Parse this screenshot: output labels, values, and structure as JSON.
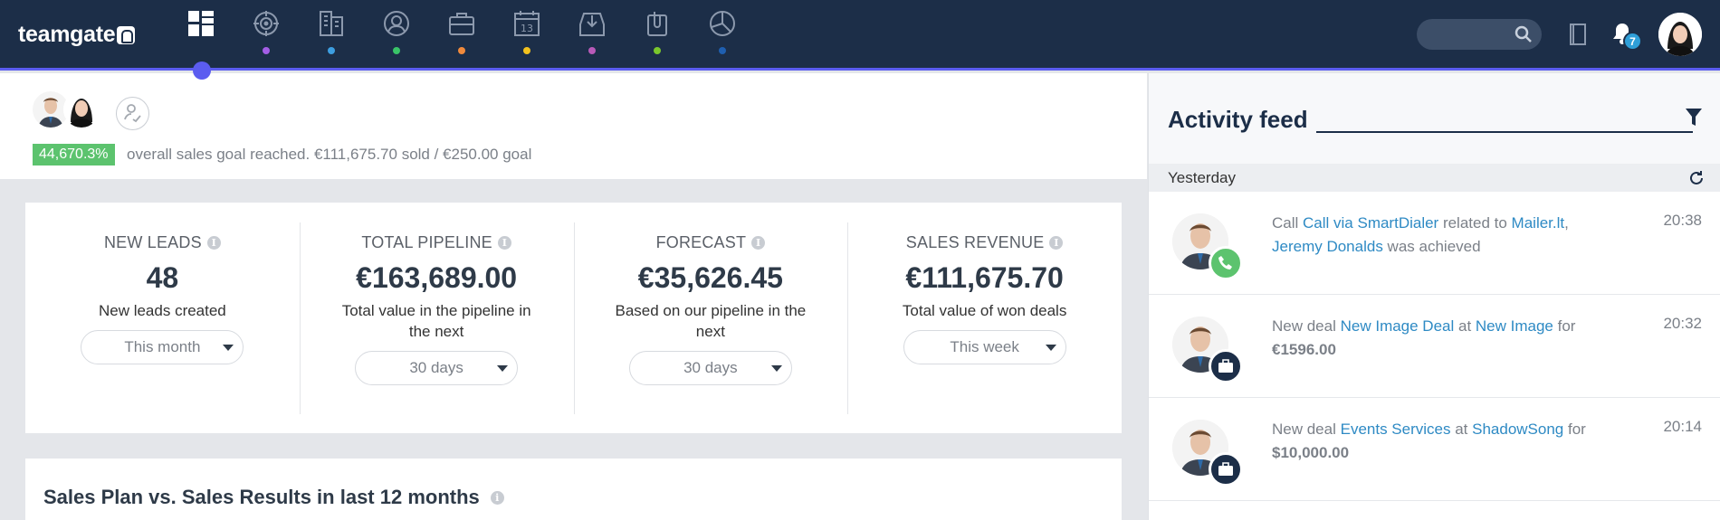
{
  "app": {
    "logo_text": "teamgate",
    "notifications_count": "7"
  },
  "nav": {
    "items": [
      {
        "name": "dashboard-icon",
        "dot": null,
        "active": true
      },
      {
        "name": "target-icon",
        "dot": "#a45ee6"
      },
      {
        "name": "buildings-icon",
        "dot": "#3d9ee0"
      },
      {
        "name": "contact-icon",
        "dot": "#39c468"
      },
      {
        "name": "briefcase-icon",
        "dot": "#f08a3c"
      },
      {
        "name": "calendar-icon",
        "dot": "#f2c21e"
      },
      {
        "name": "inbox-icon",
        "dot": "#b85ab8"
      },
      {
        "name": "attachment-icon",
        "dot": "#7ac72c"
      },
      {
        "name": "pie-chart-icon",
        "dot": "#1f5fb0"
      }
    ]
  },
  "summary": {
    "goal_percent": "44,670.3%",
    "goal_text": "overall sales goal reached.  €111,675.70 sold / €250.00 goal"
  },
  "kpis": [
    {
      "title": "NEW LEADS",
      "value": "48",
      "desc": "New leads created",
      "select": "This month"
    },
    {
      "title": "TOTAL PIPELINE",
      "value": "€163,689.00",
      "desc": "Total value in the pipeline in the next",
      "select": "30 days"
    },
    {
      "title": "FORECAST",
      "value": "€35,626.45",
      "desc": "Based on our pipeline in the next",
      "select": "30 days"
    },
    {
      "title": "SALES REVENUE",
      "value": "€111,675.70",
      "desc": "Total value of won deals",
      "select": "This week"
    }
  ],
  "plan": {
    "title": "Sales Plan vs. Sales Results in last 12 months"
  },
  "feed": {
    "title": "Activity feed",
    "day": "Yesterday",
    "items": [
      {
        "time": "20:38",
        "parts": [
          "Call ",
          "Call via SmartDialer",
          " related to ",
          "Mailer.lt",
          ",",
          "Jeremy Donalds",
          " was achieved"
        ],
        "type": "call"
      },
      {
        "time": "20:32",
        "parts": [
          "New deal ",
          "New Image Deal",
          " at ",
          "New Image",
          " for",
          "€1596.00"
        ],
        "type": "deal"
      },
      {
        "time": "20:14",
        "parts": [
          "New deal ",
          "Events Services",
          " at ",
          "ShadowSong",
          " for",
          "$10,000.00"
        ],
        "type": "deal"
      }
    ]
  },
  "colors": {
    "topbar": "#1c2e48",
    "accent": "#5b5cf0",
    "goal_green": "#5cc36e",
    "link": "#2e8ac4",
    "call_green": "#5cc36e",
    "deal_navy": "#1c2e48"
  }
}
